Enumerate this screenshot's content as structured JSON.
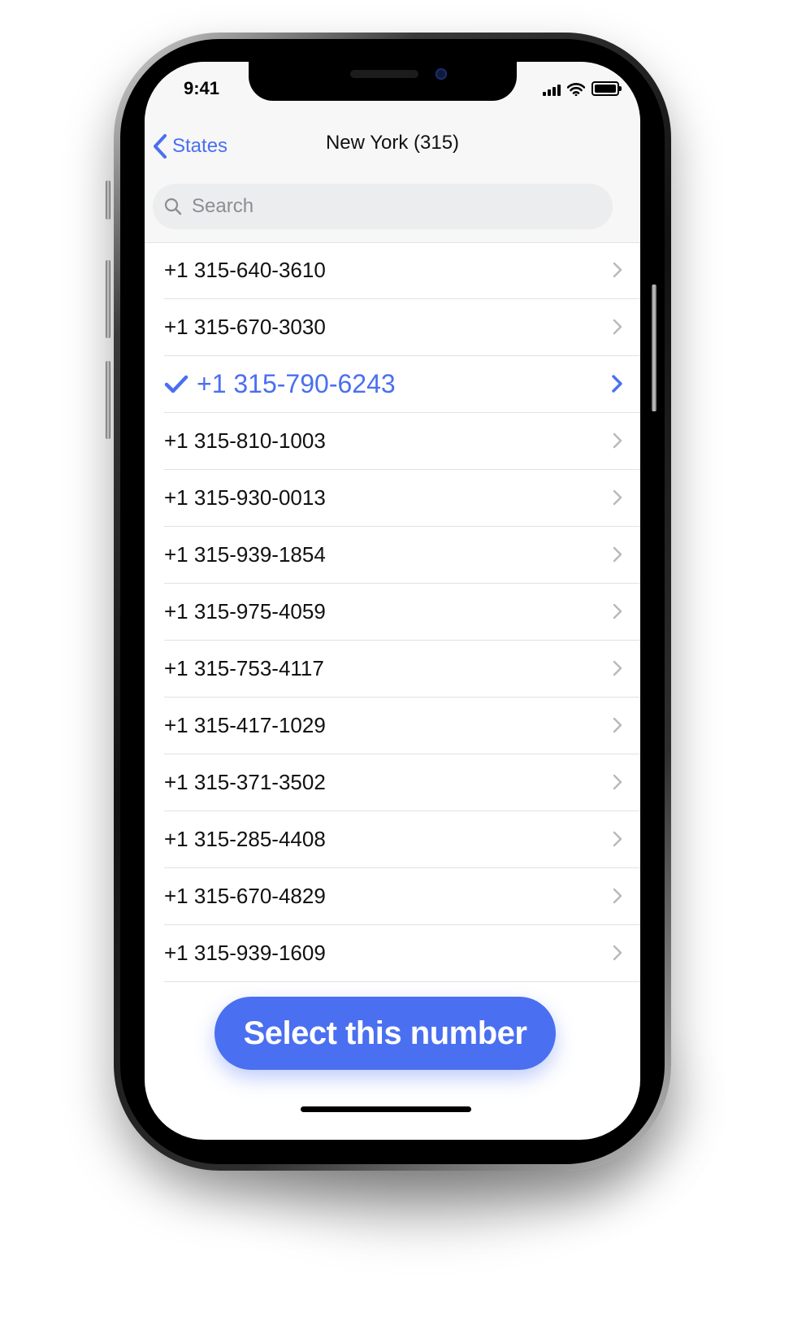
{
  "status_bar": {
    "time": "9:41"
  },
  "nav": {
    "back_label": "States",
    "title": "New York (315)"
  },
  "search": {
    "placeholder": "Search"
  },
  "numbers": [
    {
      "number": "+1 315-640-3610",
      "selected": false
    },
    {
      "number": "+1 315-670-3030",
      "selected": false
    },
    {
      "number": "+1 315-790-6243",
      "selected": true
    },
    {
      "number": "+1 315-810-1003",
      "selected": false
    },
    {
      "number": "+1 315-930-0013",
      "selected": false
    },
    {
      "number": "+1 315-939-1854",
      "selected": false
    },
    {
      "number": "+1 315-975-4059",
      "selected": false
    },
    {
      "number": "+1 315-753-4117",
      "selected": false
    },
    {
      "number": "+1 315-417-1029",
      "selected": false
    },
    {
      "number": "+1 315-371-3502",
      "selected": false
    },
    {
      "number": "+1 315-285-4408",
      "selected": false
    },
    {
      "number": "+1 315-670-4829",
      "selected": false
    },
    {
      "number": "+1 315-939-1609",
      "selected": false
    }
  ],
  "cta": {
    "label": "Select this number"
  },
  "colors": {
    "accent": "#4a6ff0",
    "text": "#111111",
    "chevron": "#b8b8bd"
  },
  "icons": {
    "back": "chevron-left-icon",
    "search": "search-icon",
    "row": "chevron-right-icon",
    "selected": "checkmark-icon"
  }
}
